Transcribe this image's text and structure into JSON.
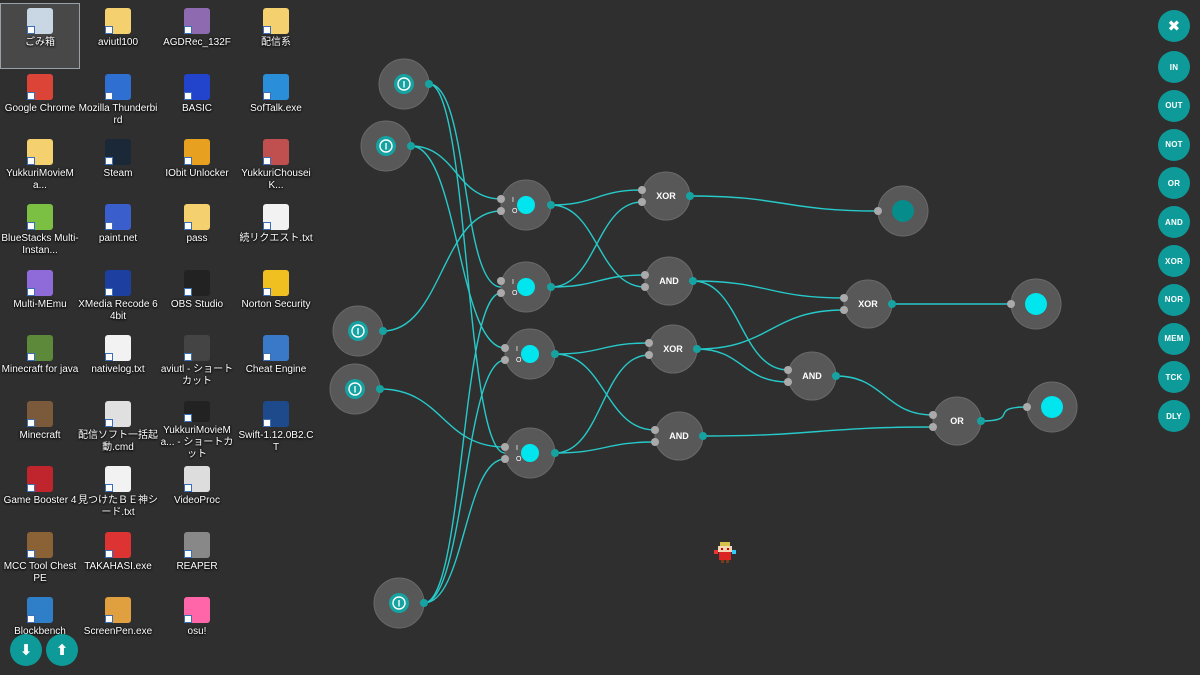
{
  "desktop": {
    "icons": [
      {
        "label": "ごみ箱",
        "icon": "recycle-bin-icon",
        "color": "#c9d6e3"
      },
      {
        "label": "Google Chrome",
        "icon": "chrome-icon",
        "color": "#db4437"
      },
      {
        "label": "YukkuriMovieMa...",
        "icon": "folder-icon",
        "color": "#f4d06f"
      },
      {
        "label": "BlueStacks Multi-Instan...",
        "icon": "bluestacks-icon",
        "color": "#7bc043"
      },
      {
        "label": "Multi-MEmu",
        "icon": "memu-icon",
        "color": "#8e6bd8"
      },
      {
        "label": "Minecraft for java",
        "icon": "minecraft-grass-icon",
        "color": "#5d8a3a"
      },
      {
        "label": "Minecraft",
        "icon": "minecraft-dirt-icon",
        "color": "#7a5a3a"
      },
      {
        "label": "Game Booster 4",
        "icon": "game-booster-icon",
        "color": "#c0242c"
      },
      {
        "label": "MCC Tool Chest PE",
        "icon": "chest-icon",
        "color": "#8a6235"
      },
      {
        "label": "Blockbench",
        "icon": "blockbench-icon",
        "color": "#2f7fc8"
      },
      {
        "label": "aviutl100",
        "icon": "zip-folder-icon",
        "color": "#f4d06f"
      },
      {
        "label": "Mozilla Thunderbird",
        "icon": "thunderbird-icon",
        "color": "#2f6fd1"
      },
      {
        "label": "Steam",
        "icon": "steam-icon",
        "color": "#1b2838"
      },
      {
        "label": "paint.net",
        "icon": "paintnet-icon",
        "color": "#3a5fcd"
      },
      {
        "label": "XMedia Recode 64bit",
        "icon": "film-icon",
        "color": "#1d3fa0"
      },
      {
        "label": "nativelog.txt",
        "icon": "text-file-icon",
        "color": "#f2f2f2"
      },
      {
        "label": "配信ソフト一括起動.cmd",
        "icon": "cmd-file-icon",
        "color": "#e0e0e0"
      },
      {
        "label": "見つけたＢＥ神シード.txt",
        "icon": "text-file-icon",
        "color": "#f2f2f2"
      },
      {
        "label": "TAKAHASI.exe",
        "icon": "takahasi-icon",
        "color": "#d33"
      },
      {
        "label": "ScreenPen.exe",
        "icon": "pen-icon",
        "color": "#e0a040"
      },
      {
        "label": "AGDRec_132F",
        "icon": "zip-folder-icon",
        "color": "#8e6bb0"
      },
      {
        "label": "BASIC",
        "icon": "basic-icon",
        "color": "#2244cc"
      },
      {
        "label": "IObit Unlocker",
        "icon": "lock-icon",
        "color": "#e8a020"
      },
      {
        "label": "pass",
        "icon": "zip-folder-icon",
        "color": "#f4d06f"
      },
      {
        "label": "OBS Studio",
        "icon": "obs-icon",
        "color": "#222"
      },
      {
        "label": "aviutl - ショートカット",
        "icon": "film-strip-icon",
        "color": "#444"
      },
      {
        "label": "YukkuriMovieMa... - ショートカット",
        "icon": "yukkuri-icon",
        "color": "#222"
      },
      {
        "label": "VideoProc",
        "icon": "videoproc-icon",
        "color": "#ddd"
      },
      {
        "label": "REAPER",
        "icon": "reaper-icon",
        "color": "#888"
      },
      {
        "label": "osu!",
        "icon": "osu-icon",
        "color": "#ff66aa"
      },
      {
        "label": "配信系",
        "icon": "folder-icon",
        "color": "#f4d06f"
      },
      {
        "label": "SofTalk.exe",
        "icon": "softalk-icon",
        "color": "#2a8fd8"
      },
      {
        "label": "YukkuriChouseiK...",
        "icon": "yukkuri-chousei-icon",
        "color": "#c05050"
      },
      {
        "label": "続リクエスト.txt",
        "icon": "text-file-icon",
        "color": "#f2f2f2"
      },
      {
        "label": "Norton Security",
        "icon": "norton-icon",
        "color": "#f0c020"
      },
      {
        "label": "Cheat Engine",
        "icon": "cheat-engine-icon",
        "color": "#3a78c8"
      },
      {
        "label": "Swift-1.12.0B2.CT",
        "icon": "cheat-table-icon",
        "color": "#1e4a8c"
      }
    ]
  },
  "actions": {
    "download_icon": "⬇",
    "upload_icon": "⬆"
  },
  "toolbar": {
    "close": "✖",
    "items": [
      "IN",
      "OUT",
      "NOT",
      "OR",
      "AND",
      "XOR",
      "NOR",
      "MEM",
      "TCK",
      "DLY"
    ]
  },
  "circuit": {
    "accent": "#17a2a2",
    "wire": "#27c9c9",
    "node_fill": "#585858",
    "led_on": "#00e5ee",
    "led_off": "#078c8c",
    "input_symbol": "I",
    "gates": {
      "xor1": "XOR",
      "and1": "AND",
      "xor2": "XOR",
      "and2": "AND",
      "xor3": "XOR",
      "and3": "AND",
      "or1": "OR"
    },
    "mux_labels": [
      "I",
      "O"
    ]
  }
}
